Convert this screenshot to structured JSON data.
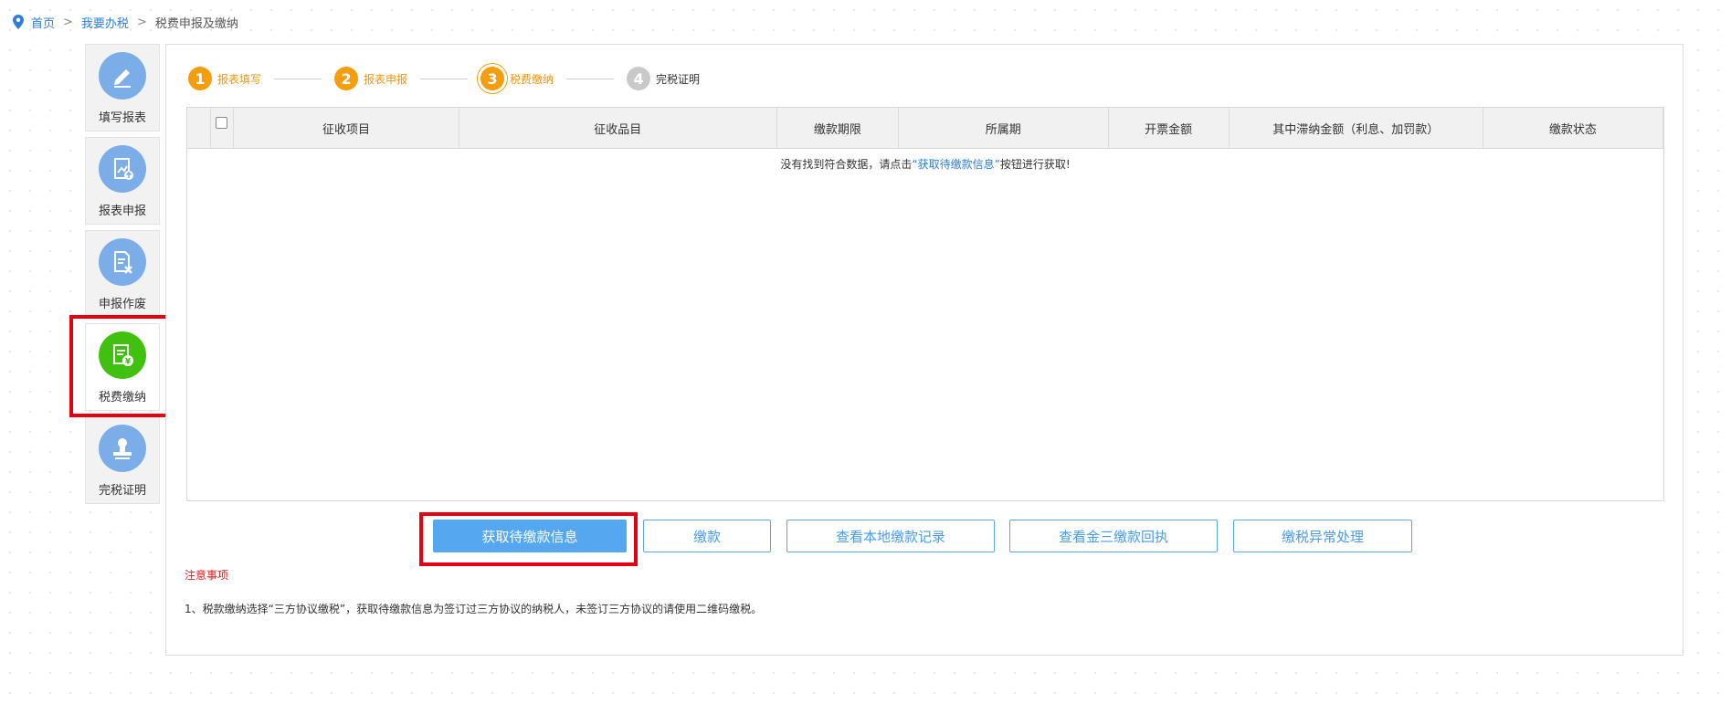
{
  "breadcrumb": {
    "home": "首页",
    "level2": "我要办税",
    "current": "税费申报及缴纳",
    "separator": ">"
  },
  "sidebar": {
    "items": [
      {
        "label": "填写报表",
        "icon": "edit-pen-icon"
      },
      {
        "label": "报表申报",
        "icon": "report-upload-icon"
      },
      {
        "label": "申报作废",
        "icon": "document-void-icon"
      },
      {
        "label": "税费缴纳",
        "icon": "tax-payment-icon",
        "active": true
      },
      {
        "label": "完税证明",
        "icon": "stamp-icon"
      }
    ]
  },
  "steps": [
    {
      "num": "1",
      "label": "报表填写",
      "state": "done"
    },
    {
      "num": "2",
      "label": "报表申报",
      "state": "done"
    },
    {
      "num": "3",
      "label": "税费缴纳",
      "state": "current"
    },
    {
      "num": "4",
      "label": "完税证明",
      "state": "todo"
    }
  ],
  "table": {
    "columns": [
      "征收项目",
      "征收品目",
      "缴款期限",
      "所属期",
      "开票金额",
      "其中滞纳金额（利息、加罚款）",
      "缴款状态"
    ],
    "empty_prefix": "没有找到符合数据，请点击",
    "empty_link": "“获取待缴款信息”",
    "empty_suffix": "按钮进行获取!"
  },
  "buttons": {
    "fetch": "获取待缴款信息",
    "pay": "缴款",
    "local_records": "查看本地缴款记录",
    "jinsan_receipt": "查看金三缴款回执",
    "exception": "缴税异常处理"
  },
  "notice": {
    "title": "注意事项",
    "text": "1、税款缴纳选择“三方协议缴税”，获取待缴款信息为签订过三方协议的纳税人，未签订三方协议的请使用二维码缴税。"
  },
  "colors": {
    "accent": "#55a7f0",
    "step_orange": "#f59d0d",
    "highlight_red": "#e60012",
    "active_green": "#41c10f"
  }
}
